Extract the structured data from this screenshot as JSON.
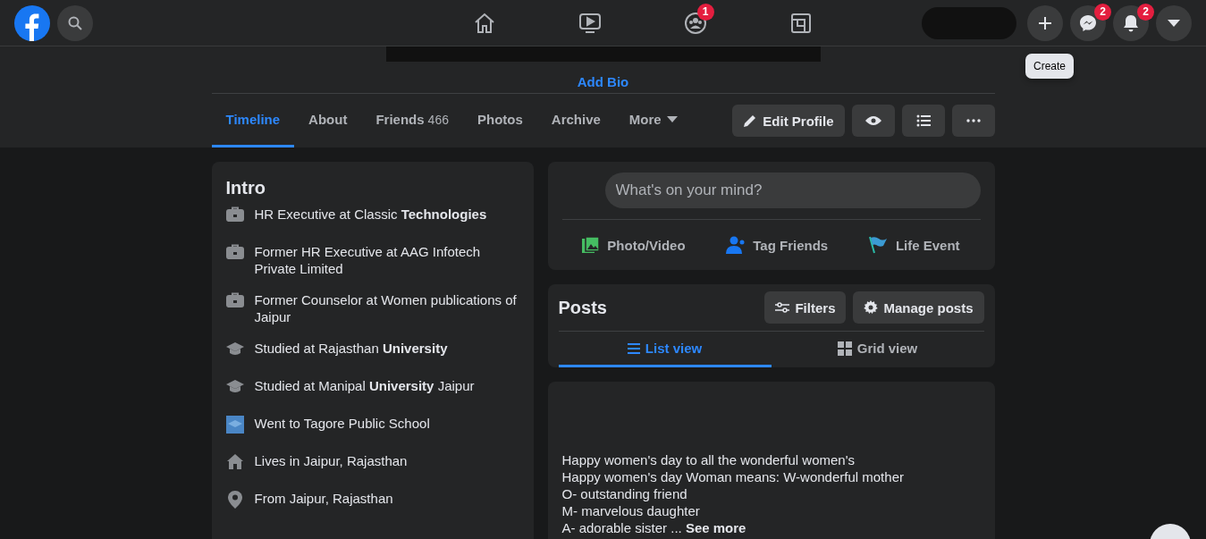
{
  "top_bar": {
    "nav": [
      {
        "kind": "home",
        "selected": false
      },
      {
        "kind": "watch",
        "selected": false
      },
      {
        "kind": "groups",
        "selected": false,
        "badge": "1"
      },
      {
        "kind": "gaming",
        "selected": false
      }
    ],
    "actions": [
      {
        "kind": "create"
      },
      {
        "kind": "messenger",
        "badge": "2"
      },
      {
        "kind": "notifications",
        "badge": "2"
      },
      {
        "kind": "account"
      }
    ],
    "tooltip": "Create"
  },
  "profile": {
    "add_bio": "Add Bio",
    "tabs": [
      {
        "label": "Timeline",
        "selected": true
      },
      {
        "label": "About",
        "selected": false
      },
      {
        "label": "Friends",
        "count": "466",
        "selected": false
      },
      {
        "label": "Photos",
        "selected": false
      },
      {
        "label": "Archive",
        "selected": false
      },
      {
        "label": "More",
        "selected": false
      }
    ],
    "edit_button": "Edit Profile"
  },
  "intro": {
    "title": "Intro",
    "items": [
      {
        "kind": "work",
        "text": "HR Executive at Classic **Technologies**"
      },
      {
        "kind": "work",
        "text": "Former HR Executive at AAG Infotech Private Limited"
      },
      {
        "kind": "work",
        "text": "Former Counselor at Women publications of Jaipur"
      },
      {
        "kind": "school",
        "text": "Studied at Rajasthan **University**"
      },
      {
        "kind": "school",
        "text": "Studied at Manipal **University** Jaipur"
      },
      {
        "kind": "highschool",
        "text": "Went to Tagore Public School"
      },
      {
        "kind": "home",
        "text": "Lives in Jaipur, Rajasthan"
      },
      {
        "kind": "pin",
        "text": "From Jaipur, Rajasthan"
      }
    ]
  },
  "composer": {
    "placeholder": "What's on your mind?",
    "actions": [
      {
        "kind": "photo",
        "label": "Photo/Video"
      },
      {
        "kind": "tag",
        "label": "Tag Friends"
      },
      {
        "kind": "event",
        "label": "Life Event"
      }
    ]
  },
  "posts": {
    "title": "Posts",
    "filters": "Filters",
    "manage": "Manage posts",
    "views": [
      {
        "kind": "list",
        "label": "List view",
        "selected": true
      },
      {
        "kind": "grid",
        "label": "Grid view",
        "selected": false
      }
    ]
  },
  "post": {
    "lines": [
      "Happy women's day to all the wonderful women's",
      "Happy women's day Woman means: W-wonderful mother",
      "O- outstanding friend",
      "M- marvelous daughter",
      "A- adorable sister ..."
    ],
    "see_more": "See more"
  }
}
